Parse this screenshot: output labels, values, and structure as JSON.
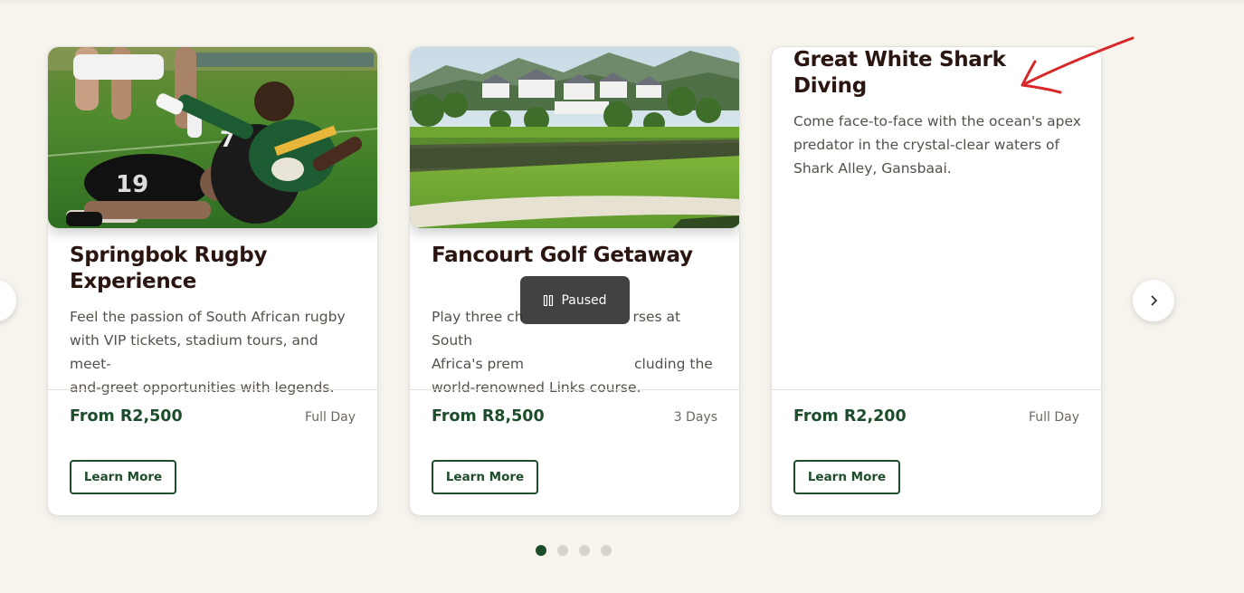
{
  "carousel": {
    "cards": [
      {
        "title": "Springbok Rugby Experience",
        "title_lines": [
          "Springbok Rugby",
          "Experience"
        ],
        "description": "Feel the passion of South African rugby with VIP tickets, stadium tours, and meet-and-greet opportunities with legends.",
        "desc_lines": [
          "Feel the passion of South African rugby",
          "with VIP tickets, stadium tours, and meet-",
          "and-greet opportunities with legends."
        ],
        "price": "From R2,500",
        "duration": "Full Day",
        "button": "Learn More",
        "image": "rugby-tackle-photo"
      },
      {
        "title": "Fancourt Golf Getaway",
        "title_lines": [
          "Fancourt Golf Getaway"
        ],
        "description": "Play three championship courses at South Africa's premier golf estate, including the world-renowned Links course.",
        "desc_lines": [
          "Play three ch",
          "Africa's prem",
          "world-renowned Links course."
        ],
        "desc_lines_right": [
          "rses at South",
          "cluding the",
          ""
        ],
        "price": "From R8,500",
        "duration": "3 Days",
        "button": "Learn More",
        "image": "golf-estate-photo"
      },
      {
        "title": "Great White Shark Diving",
        "title_lines": [
          "Great White Shark",
          "Diving"
        ],
        "description": "Come face-to-face with the ocean's apex predator in the crystal-clear waters of Shark Alley, Gansbaai.",
        "desc_lines": [
          "Come face-to-face with the ocean's apex",
          "predator in the crystal-clear waters of",
          "Shark Alley, Gansbaai."
        ],
        "price": "From R2,200",
        "duration": "Full Day",
        "button": "Learn More"
      }
    ],
    "pagination": {
      "count": 4,
      "active_index": 0
    },
    "paused_label": "Paused",
    "prev_icon": "chevron-left-icon",
    "next_icon": "chevron-right-icon"
  },
  "colors": {
    "page_bg": "#f7f4ee",
    "brand_green": "#1e4d2b",
    "title": "#2a1510",
    "annotation_red": "#d62828"
  }
}
